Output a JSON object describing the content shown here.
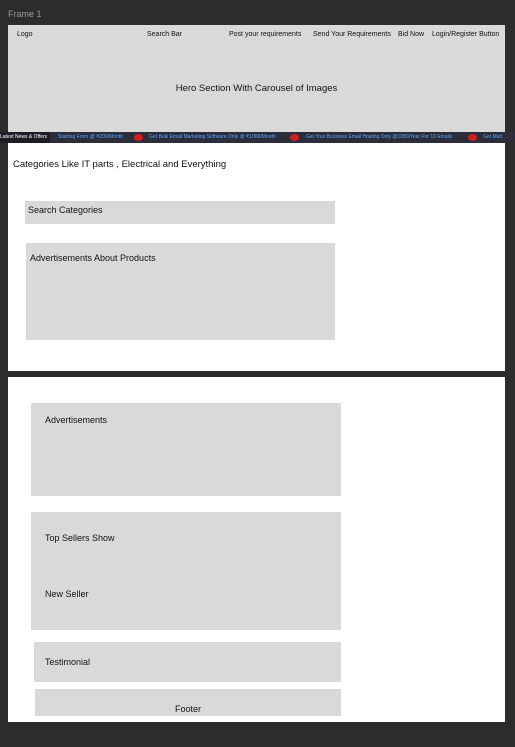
{
  "frame_label": "Frame 1",
  "nav": {
    "logo": "Logo",
    "search": "Search Bar",
    "post": "Post your requirements",
    "send": "Send Your Requirements",
    "bid": "Bid Now",
    "login": "Login/Register Button"
  },
  "hero_title": "Hero Section With Carousel of Images",
  "ticker": {
    "lead": "Latest News & Offers",
    "items": [
      "Starting From @ ₹200/Month",
      "Get Bulk Email Marketing Software Only @ ₹1000/Month",
      "Get Your Business Email Hosting Only @1080/Year For 10 Emails",
      "Get Mult"
    ],
    "lead_color": "#1b1c26",
    "text_color": "#5aa7ff",
    "badge_color": "#d11f1f"
  },
  "categories_text": "Categories Like IT parts , Electrical and Everything",
  "search_categories": "Search Categories",
  "ads_products": "Advertisements About Products",
  "advertisements": "Advertisements",
  "top_sellers": "Top Sellers Show",
  "new_seller": "New Seller",
  "testimonial": "Testimonial",
  "footer": "Footer"
}
